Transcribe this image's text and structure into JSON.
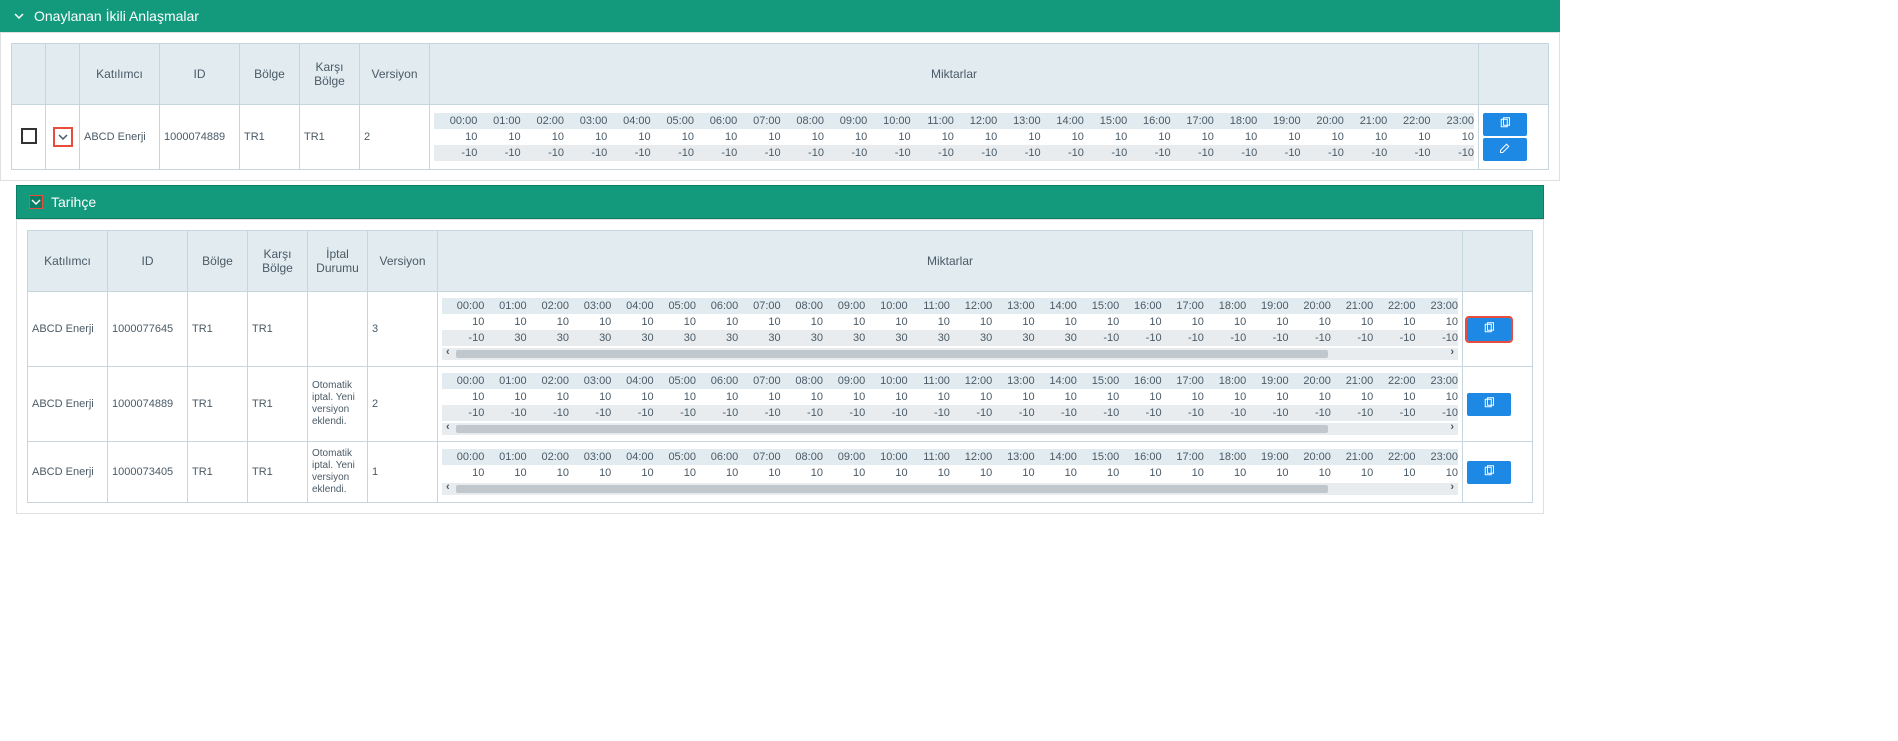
{
  "colors": {
    "primary": "#139a7d",
    "accent": "#1e88e5",
    "highlight": "#e74c3c"
  },
  "approved": {
    "title": "Onaylanan İkili Anlaşmalar",
    "headers": [
      "Katılımcı",
      "ID",
      "Bölge",
      "Karşı Bölge",
      "Versiyon",
      "Miktarlar"
    ],
    "row": {
      "katilimci": "ABCD Enerji",
      "id": "1000074889",
      "bolge": "TR1",
      "karsi_bolge": "TR1",
      "versiyon": "2",
      "hours": [
        "00:00",
        "01:00",
        "02:00",
        "03:00",
        "04:00",
        "05:00",
        "06:00",
        "07:00",
        "08:00",
        "09:00",
        "10:00",
        "11:00",
        "12:00",
        "13:00",
        "14:00",
        "15:00",
        "16:00",
        "17:00",
        "18:00",
        "19:00",
        "20:00",
        "21:00",
        "22:00",
        "23:00"
      ],
      "vals1": [
        "10",
        "10",
        "10",
        "10",
        "10",
        "10",
        "10",
        "10",
        "10",
        "10",
        "10",
        "10",
        "10",
        "10",
        "10",
        "10",
        "10",
        "10",
        "10",
        "10",
        "10",
        "10",
        "10",
        "10"
      ],
      "vals2": [
        "-10",
        "-10",
        "-10",
        "-10",
        "-10",
        "-10",
        "-10",
        "-10",
        "-10",
        "-10",
        "-10",
        "-10",
        "-10",
        "-10",
        "-10",
        "-10",
        "-10",
        "-10",
        "-10",
        "-10",
        "-10",
        "-10",
        "-10",
        "-10"
      ]
    }
  },
  "history": {
    "title": "Tarihçe",
    "headers": [
      "Katılımcı",
      "ID",
      "Bölge",
      "Karşı Bölge",
      "İptal Durumu",
      "Versiyon",
      "Miktarlar"
    ],
    "rows": [
      {
        "katilimci": "ABCD Enerji",
        "id": "1000077645",
        "bolge": "TR1",
        "karsi_bolge": "TR1",
        "iptal": "",
        "versiyon": "3",
        "hours": [
          "00:00",
          "01:00",
          "02:00",
          "03:00",
          "04:00",
          "05:00",
          "06:00",
          "07:00",
          "08:00",
          "09:00",
          "10:00",
          "11:00",
          "12:00",
          "13:00",
          "14:00",
          "15:00",
          "16:00",
          "17:00",
          "18:00",
          "19:00",
          "20:00",
          "21:00",
          "22:00",
          "23:00"
        ],
        "vals1": [
          "10",
          "10",
          "10",
          "10",
          "10",
          "10",
          "10",
          "10",
          "10",
          "10",
          "10",
          "10",
          "10",
          "10",
          "10",
          "10",
          "10",
          "10",
          "10",
          "10",
          "10",
          "10",
          "10",
          "10"
        ],
        "vals2": [
          "-10",
          "30",
          "30",
          "30",
          "30",
          "30",
          "30",
          "30",
          "30",
          "30",
          "30",
          "30",
          "30",
          "30",
          "30",
          "-10",
          "-10",
          "-10",
          "-10",
          "-10",
          "-10",
          "-10",
          "-10",
          "-10"
        ],
        "highlight": true
      },
      {
        "katilimci": "ABCD Enerji",
        "id": "1000074889",
        "bolge": "TR1",
        "karsi_bolge": "TR1",
        "iptal": "Otomatik iptal. Yeni versiyon eklendi.",
        "versiyon": "2",
        "hours": [
          "00:00",
          "01:00",
          "02:00",
          "03:00",
          "04:00",
          "05:00",
          "06:00",
          "07:00",
          "08:00",
          "09:00",
          "10:00",
          "11:00",
          "12:00",
          "13:00",
          "14:00",
          "15:00",
          "16:00",
          "17:00",
          "18:00",
          "19:00",
          "20:00",
          "21:00",
          "22:00",
          "23:00"
        ],
        "vals1": [
          "10",
          "10",
          "10",
          "10",
          "10",
          "10",
          "10",
          "10",
          "10",
          "10",
          "10",
          "10",
          "10",
          "10",
          "10",
          "10",
          "10",
          "10",
          "10",
          "10",
          "10",
          "10",
          "10",
          "10"
        ],
        "vals2": [
          "-10",
          "-10",
          "-10",
          "-10",
          "-10",
          "-10",
          "-10",
          "-10",
          "-10",
          "-10",
          "-10",
          "-10",
          "-10",
          "-10",
          "-10",
          "-10",
          "-10",
          "-10",
          "-10",
          "-10",
          "-10",
          "-10",
          "-10",
          "-10"
        ],
        "highlight": false
      },
      {
        "katilimci": "ABCD Enerji",
        "id": "1000073405",
        "bolge": "TR1",
        "karsi_bolge": "TR1",
        "iptal": "Otomatik iptal. Yeni versiyon eklendi.",
        "versiyon": "1",
        "hours": [
          "00:00",
          "01:00",
          "02:00",
          "03:00",
          "04:00",
          "05:00",
          "06:00",
          "07:00",
          "08:00",
          "09:00",
          "10:00",
          "11:00",
          "12:00",
          "13:00",
          "14:00",
          "15:00",
          "16:00",
          "17:00",
          "18:00",
          "19:00",
          "20:00",
          "21:00",
          "22:00",
          "23:00"
        ],
        "vals1": [
          "10",
          "10",
          "10",
          "10",
          "10",
          "10",
          "10",
          "10",
          "10",
          "10",
          "10",
          "10",
          "10",
          "10",
          "10",
          "10",
          "10",
          "10",
          "10",
          "10",
          "10",
          "10",
          "10",
          "10"
        ],
        "vals2": [],
        "highlight": false
      }
    ]
  },
  "icons": {
    "copy": "copy-icon",
    "edit": "edit-icon",
    "chevron_down": "chevron-down-icon"
  }
}
